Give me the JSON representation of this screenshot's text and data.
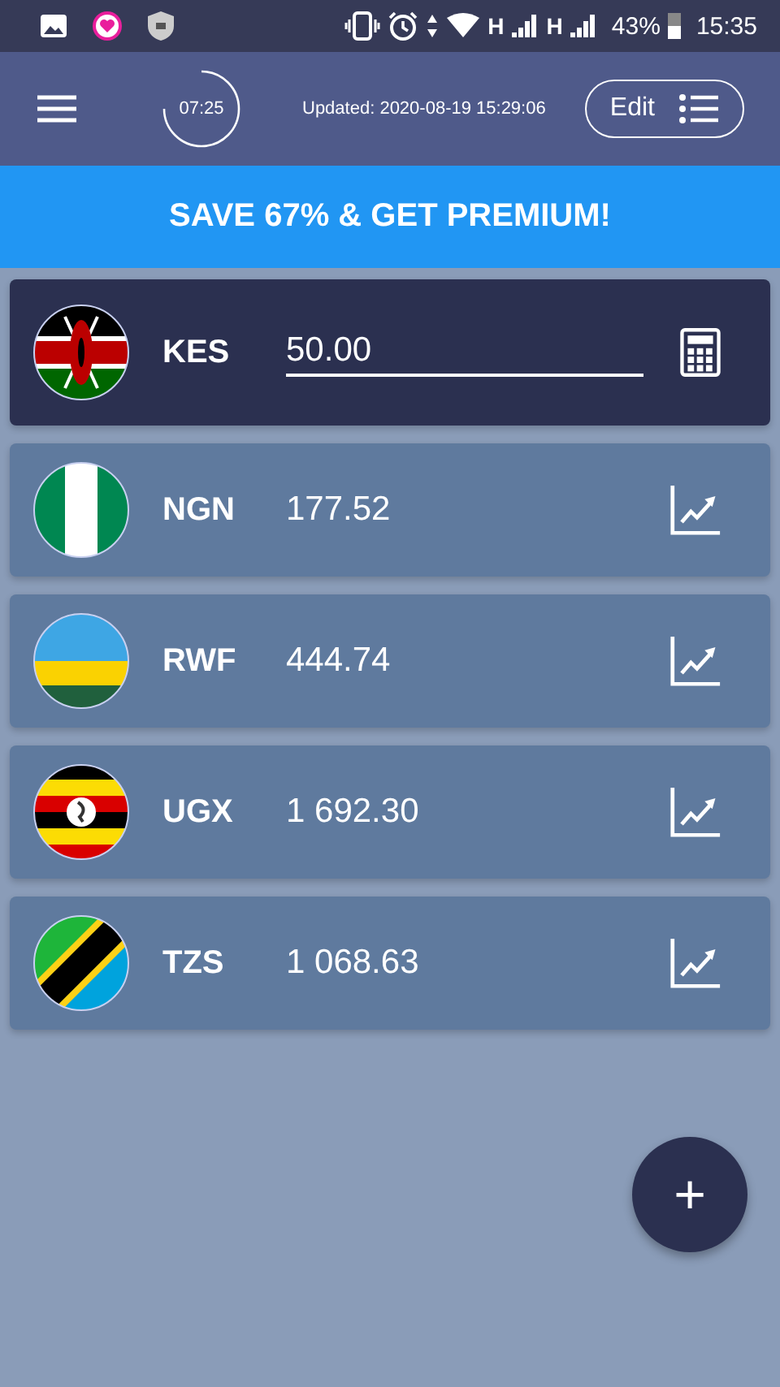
{
  "status_bar": {
    "network_labels": [
      "H",
      "H"
    ],
    "battery": "43%",
    "time": "15:35"
  },
  "app_bar": {
    "timer": "07:25",
    "updated": "Updated: 2020-08-19 15:29:06",
    "edit_button": "Edit"
  },
  "banner": "SAVE 67% & GET PREMIUM!",
  "currencies": [
    {
      "code": "KES",
      "kind": "kenya",
      "amount": "50.00",
      "selected": true
    },
    {
      "code": "NGN",
      "kind": "nigeria",
      "amount": "177.52",
      "selected": false
    },
    {
      "code": "RWF",
      "kind": "rwanda",
      "amount": "444.74",
      "selected": false
    },
    {
      "code": "UGX",
      "kind": "uganda",
      "amount": "1 692.30",
      "selected": false
    },
    {
      "code": "TZS",
      "kind": "tanzania",
      "amount": "1 068.63",
      "selected": false
    }
  ],
  "fab": "+"
}
